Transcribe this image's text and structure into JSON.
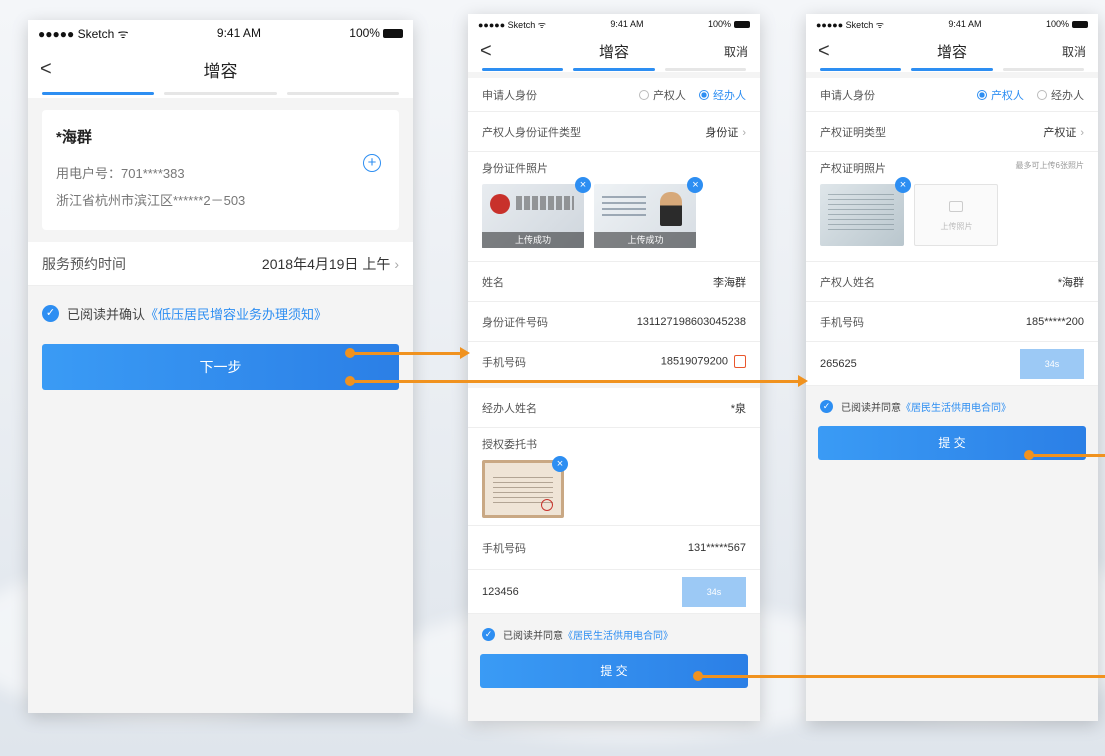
{
  "status": {
    "carrier": "●●●●● Sketch ᯤ",
    "time": "9:41 AM",
    "battery": "100%"
  },
  "screen1": {
    "nav_back": "<",
    "title": "增容",
    "account": {
      "name": "*海群",
      "meter": "用电户号：701****383",
      "address": "浙江省杭州市滨江区******2－503"
    },
    "service_label": "服务预约时间",
    "service_value": "2018年4月19日 上午",
    "agree_prefix": "已阅读并确认",
    "agree_link": "《低压居民增容业务办理须知》",
    "next": "下一步"
  },
  "screen2": {
    "title": "增容",
    "cancel": "取消",
    "identity_label": "申请人身份",
    "opt_owner": "产权人",
    "opt_agent": "经办人",
    "idtype_label": "产权人身份证件类型",
    "idtype_value": "身份证",
    "photo_label": "身份证件照片",
    "upload_ok": "上传成功",
    "name_label": "姓名",
    "name_value": "李海群",
    "idno_label": "身份证件号码",
    "idno_value": "131127198603045238",
    "phone_label": "手机号码",
    "phone_value": "18519079200",
    "agent_name_label": "经办人姓名",
    "agent_name_value": "*泉",
    "auth_label": "授权委托书",
    "phone2_label": "手机号码",
    "phone2_value": "131*****567",
    "code_value": "123456",
    "code_btn": "34s",
    "agree_prefix": "已阅读并同意",
    "agree_link": "《居民生活供用电合同》",
    "submit": "提 交"
  },
  "screen3": {
    "title": "增容",
    "cancel": "取消",
    "identity_label": "申请人身份",
    "opt_owner": "产权人",
    "opt_agent": "经办人",
    "cert_label": "产权证明类型",
    "cert_value": "产权证",
    "photo_label": "产权证明照片",
    "photo_hint": "最多可上传6张照片",
    "upload_label": "上传照片",
    "owner_label": "产权人姓名",
    "owner_value": "*海群",
    "phone_label": "手机号码",
    "phone_value": "185*****200",
    "code_value": "265625",
    "code_btn": "34s",
    "agree_prefix": "已阅读并同意",
    "agree_link": "《居民生活供用电合同》",
    "submit": "提 交"
  },
  "colors": {
    "accent": "#2d8ef2",
    "arrow": "#f0921f"
  }
}
